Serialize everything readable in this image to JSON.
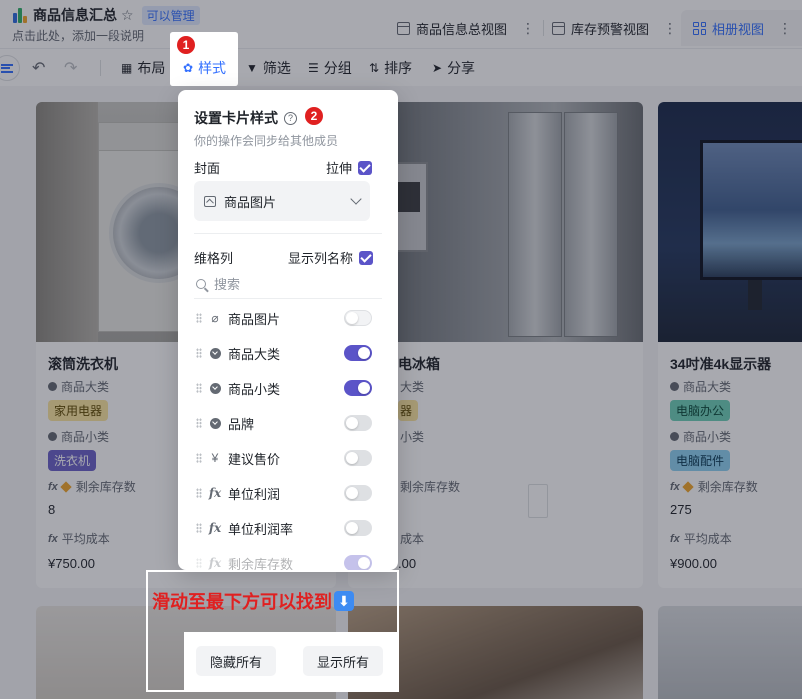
{
  "header": {
    "title": "商品信息汇总",
    "permission_badge": "可以管理",
    "description_placeholder": "点击此处，添加一段说明",
    "tabs": [
      {
        "label": "商品信息总视图"
      },
      {
        "label": "库存预警视图"
      },
      {
        "label": "相册视图"
      }
    ]
  },
  "toolbar": {
    "layout": "布局",
    "style": "样式",
    "filter": "筛选",
    "group": "分组",
    "sort": "排序",
    "share": "分享"
  },
  "cards": [
    {
      "title": "滚筒洗衣机",
      "category_label": "商品大类",
      "category": "家用电器",
      "subcategory_label": "商品小类",
      "subcategory": "洗衣机",
      "stock_label": "剩余库存数",
      "stock": "8",
      "cost_label": "平均成本",
      "cost": "¥750.00"
    },
    {
      "title_partial": "电冰箱",
      "category_label_partial": "大类",
      "category_partial": "器",
      "subcategory_label_partial": "小类",
      "stock_label_partial": "剩余库存数",
      "cost_label_partial": "成本",
      "cost_partial": ".00"
    },
    {
      "title": "34吋准4k显示器",
      "category_label": "商品大类",
      "category": "电脑办公",
      "subcategory_label": "商品小类",
      "subcategory": "电脑配件",
      "stock_label": "剩余库存数",
      "stock": "275",
      "cost_label": "平均成本",
      "cost": "¥900.00"
    }
  ],
  "panel": {
    "title": "设置卡片样式",
    "subtitle": "你的操作会同步给其他成员",
    "cover_label": "封面",
    "stretch_label": "拉伸",
    "cover_select_value": "商品图片",
    "columns_label": "维格列",
    "show_column_names_label": "显示列名称",
    "search_placeholder": "搜索",
    "fields": [
      {
        "name": "商品图片",
        "icon": "paperclip-icon",
        "on": false
      },
      {
        "name": "商品大类",
        "icon": "single-select-icon",
        "on": true
      },
      {
        "name": "商品小类",
        "icon": "single-select-icon",
        "on": true
      },
      {
        "name": "品牌",
        "icon": "single-select-icon",
        "on": false
      },
      {
        "name": "建议售价",
        "icon": "currency-icon",
        "on": false
      },
      {
        "name": "单位利润",
        "icon": "formula-icon",
        "on": false
      },
      {
        "name": "单位利润率",
        "icon": "formula-icon",
        "on": false
      },
      {
        "name": "剩余库存数",
        "icon": "formula-icon",
        "on": true
      }
    ],
    "hide_all": "隐藏所有",
    "show_all": "显示所有"
  },
  "annotations": {
    "step1": "1",
    "step2": "2",
    "scroll_hint": "滑动至最下方可以找到"
  },
  "colors": {
    "accent": "#3370ff",
    "toggle_on": "#5b54c8",
    "annotation_red": "#e02020"
  }
}
